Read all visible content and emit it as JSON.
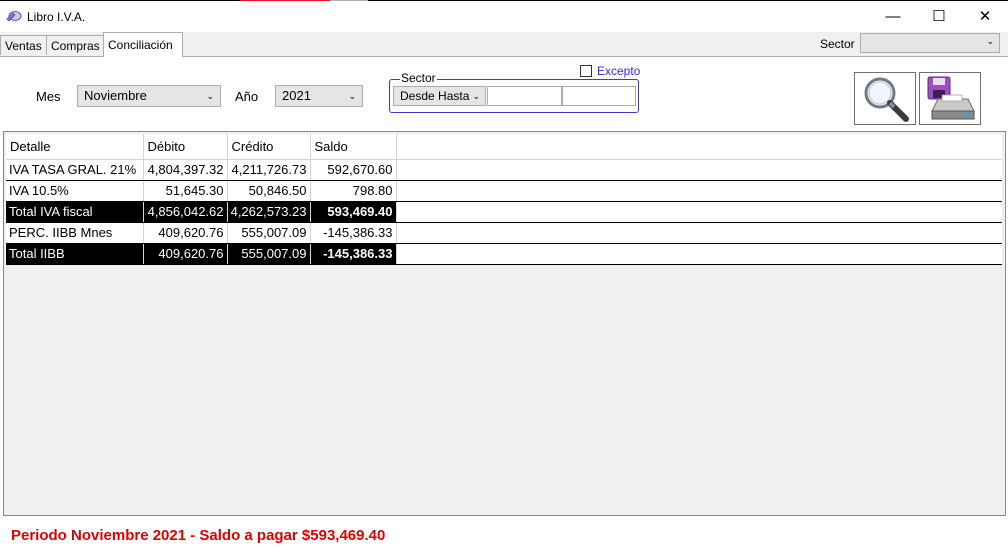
{
  "window": {
    "title": "Libro I.V.A.",
    "controls": {
      "minimize": "—",
      "maximize": "☐",
      "close": "✕"
    }
  },
  "tabs": [
    {
      "label": "Ventas",
      "active": false
    },
    {
      "label": "Compras",
      "active": false
    },
    {
      "label": "Conciliación",
      "active": true
    }
  ],
  "top_sector": {
    "label": "Sector",
    "value": ""
  },
  "filters": {
    "mes_label": "Mes",
    "mes_value": "Noviembre",
    "anio_label": "Año",
    "anio_value": "2021",
    "sector_group_label": "Sector",
    "desde_hasta_label": "Desde Hasta",
    "desde_value": "",
    "hasta_value": "",
    "excepto_label": "Excepto",
    "excepto_checked": false
  },
  "toolbar": {
    "search_icon": "magnifier-icon",
    "print_icon": "save-print-icon"
  },
  "grid": {
    "columns": [
      "Detalle",
      "Débito",
      "Crédito",
      "Saldo"
    ],
    "rows": [
      {
        "detalle": "IVA TASA GRAL. 21%",
        "debito": "4,804,397.32",
        "credito": "4,211,726.73",
        "saldo": "592,670.60",
        "total": false
      },
      {
        "detalle": "IVA 10.5%",
        "debito": "51,645.30",
        "credito": "50,846.50",
        "saldo": "798.80",
        "total": false
      },
      {
        "detalle": "Total IVA fiscal",
        "debito": "4,856,042.62",
        "credito": "4,262,573.23",
        "saldo": "593,469.40",
        "total": true
      },
      {
        "detalle": "PERC. IIBB Mnes",
        "debito": "409,620.76",
        "credito": "555,007.09",
        "saldo": "-145,386.33",
        "total": false
      },
      {
        "detalle": "Total IIBB",
        "debito": "409,620.76",
        "credito": "555,007.09",
        "saldo": "-145,386.33",
        "total": true
      }
    ]
  },
  "status": {
    "text": "Periodo Noviembre 2021 - Saldo a pagar $593,469.40",
    "color": "#e00000"
  }
}
